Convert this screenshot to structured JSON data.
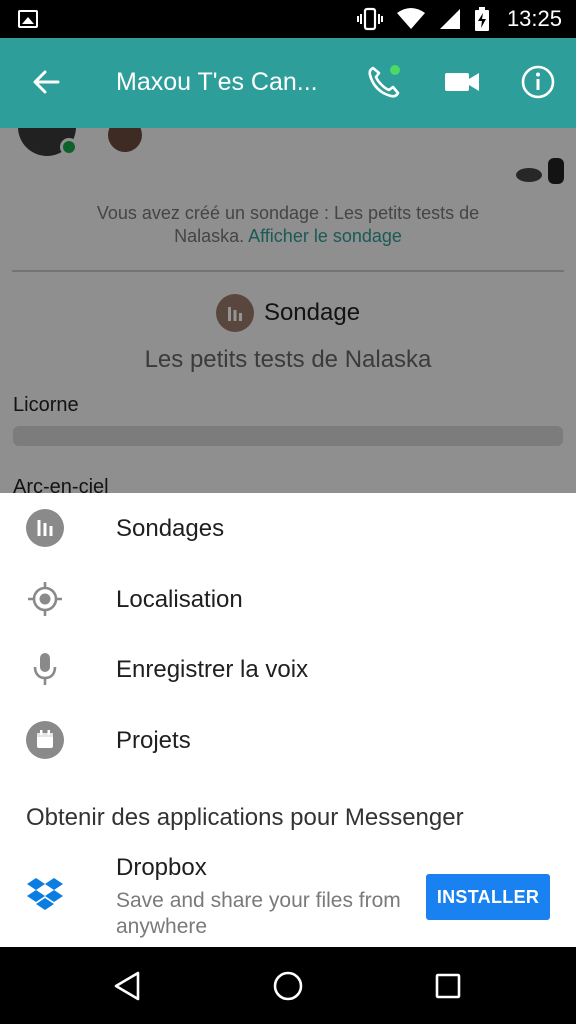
{
  "status_bar": {
    "time": "13:25"
  },
  "header": {
    "title": "Maxou T'es Can...",
    "icons": [
      "back-arrow-icon",
      "phone-call-icon",
      "video-camera-icon",
      "info-icon"
    ]
  },
  "conversation": {
    "system_message_prefix": "Vous avez créé un sondage : Les petits tests de Nalaska.",
    "system_message_link": "Afficher le sondage",
    "poll": {
      "label": "Sondage",
      "question": "Les petits tests de Nalaska",
      "options": [
        {
          "label": "Licorne",
          "votes_fraction": 0
        },
        {
          "label": "Arc-en-ciel"
        }
      ]
    }
  },
  "sheet": {
    "items": [
      {
        "label": "Sondages",
        "icon": "poll-icon"
      },
      {
        "label": "Localisation",
        "icon": "location-target-icon"
      },
      {
        "label": "Enregistrer la voix",
        "icon": "microphone-icon"
      },
      {
        "label": "Projets",
        "icon": "calendar-icon"
      }
    ],
    "section_title": "Obtenir des applications pour Messenger",
    "app": {
      "name": "Dropbox",
      "description": "Save and share your files from anywhere",
      "install_label": "INSTALLER",
      "install_color": "#1a82f0",
      "icon": "dropbox-icon"
    }
  },
  "colors": {
    "app_bar": "#2e9e9a",
    "link": "#2d9b96",
    "online": "#1aa84d"
  }
}
